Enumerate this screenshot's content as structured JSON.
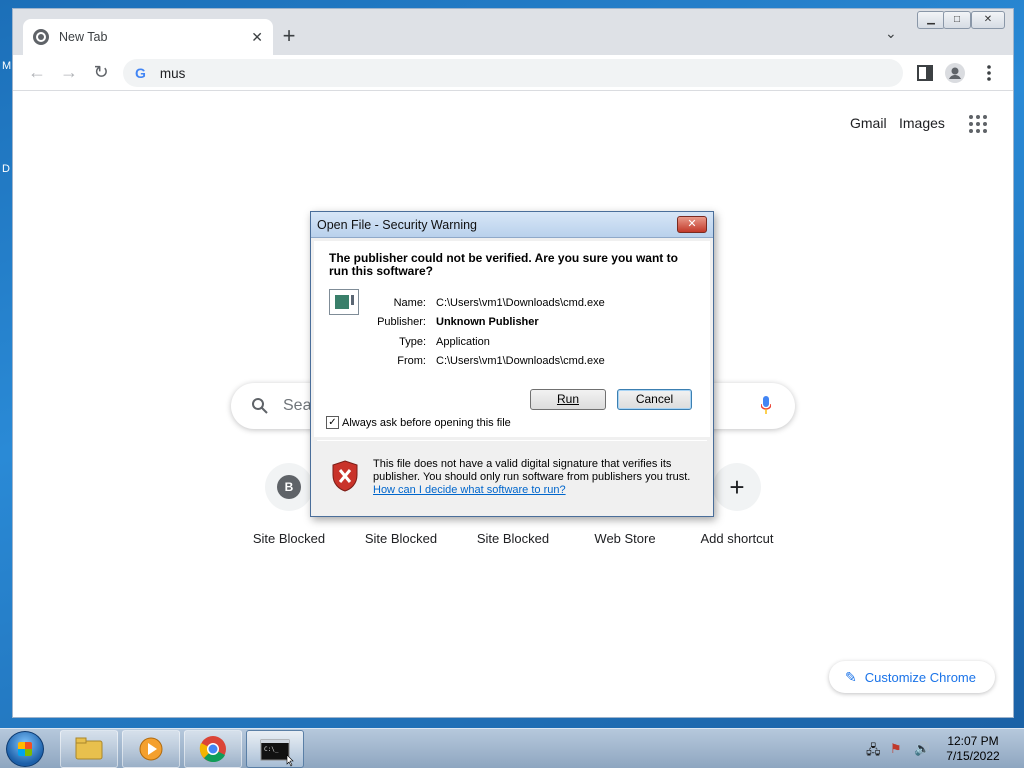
{
  "desktop": {
    "edge_glyph_1": "M",
    "edge_glyph_2": "D"
  },
  "browser": {
    "tab_title": "New Tab",
    "tab_close": "✕",
    "new_tab": "+",
    "address_text": "mus",
    "address_g": "G",
    "window_controls": {
      "minimize": "▁",
      "maximize": "□",
      "close": "✕"
    }
  },
  "ntp": {
    "gmail": "Gmail",
    "images": "Images",
    "search_placeholder": "Sea",
    "shortcuts": [
      {
        "label": "Site Blocked",
        "badge": "B"
      },
      {
        "label": "Site Blocked",
        "badge": ""
      },
      {
        "label": "Site Blocked",
        "badge": ""
      },
      {
        "label": "Web Store",
        "badge": ""
      },
      {
        "label": "Add shortcut",
        "badge": "+"
      }
    ],
    "customize": "Customize Chrome"
  },
  "dialog": {
    "title": "Open File - Security Warning",
    "heading": "The publisher could not be verified.  Are you sure you want to run this software?",
    "fields": {
      "name_k": "Name:",
      "name_v": "C:\\Users\\vm1\\Downloads\\cmd.exe",
      "publisher_k": "Publisher:",
      "publisher_v": "Unknown Publisher",
      "type_k": "Type:",
      "type_v": "Application",
      "from_k": "From:",
      "from_v": "C:\\Users\\vm1\\Downloads\\cmd.exe"
    },
    "run": "Run",
    "cancel": "Cancel",
    "checkbox_label": "Always ask before opening this file",
    "checkbox_checked": "✓",
    "warning_text": "This file does not have a valid digital signature that verifies its publisher.  You should only run software from publishers you trust.",
    "warning_link": "How can I decide what software to run?",
    "close": "✕"
  },
  "taskbar": {
    "time": "12:07 PM",
    "date": "7/15/2022"
  }
}
